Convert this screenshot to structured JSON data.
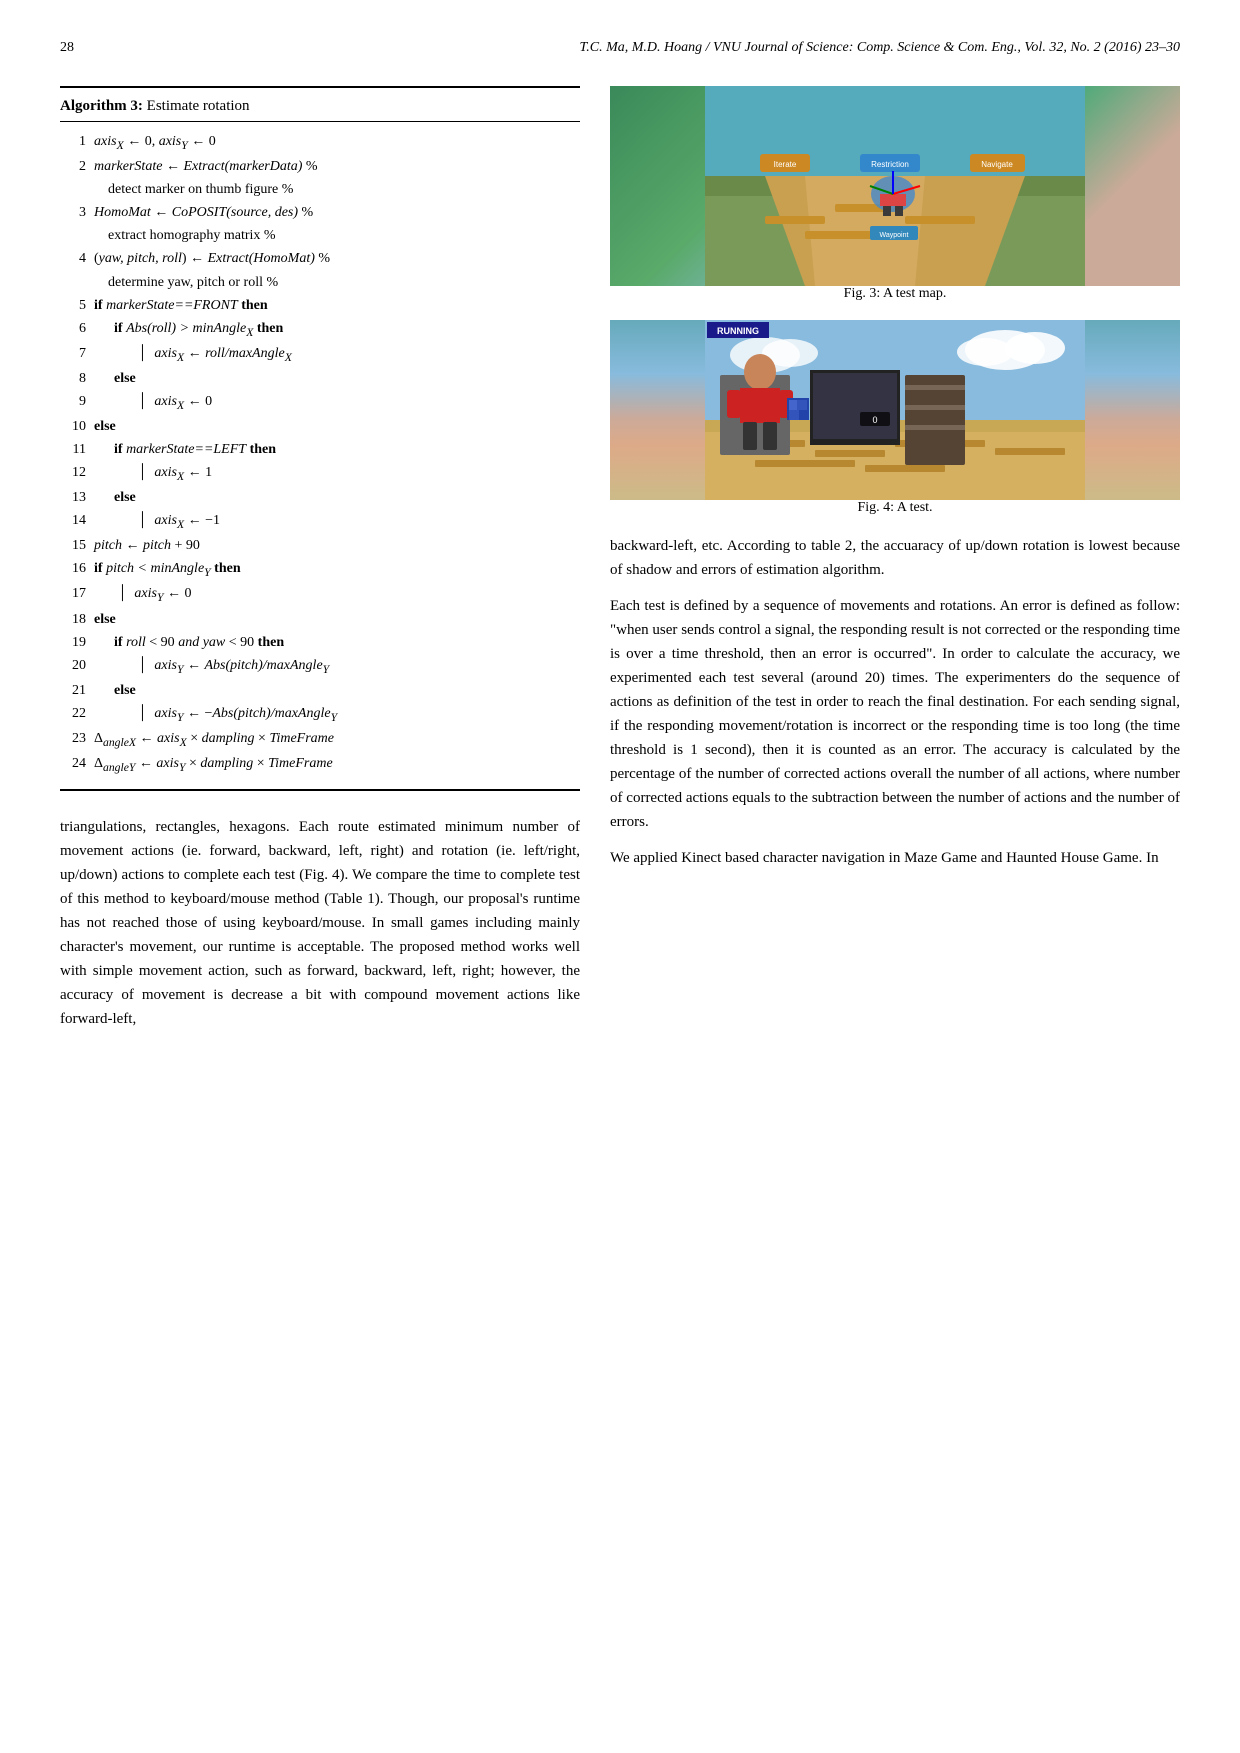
{
  "header": {
    "page_num": "28",
    "journal": "T.C. Ma, M.D. Hoang / VNU Journal of Science: Comp. Science & Com. Eng., Vol. 32, No. 2 (2016) 23–30"
  },
  "algorithm": {
    "title_label": "Algorithm 3:",
    "title_text": " Estimate rotation",
    "lines": [
      {
        "num": "1",
        "indent": 0,
        "html": "<span class='math'>axis<sub>X</sub></span> ← 0, <span class='math'>axis<sub>Y</sub></span> ← 0"
      },
      {
        "num": "2",
        "indent": 0,
        "html": "<span class='math'>markerState</span> ← <span class='math'>Extract(markerData)</span> % detect marker on thumb figure %"
      },
      {
        "num": "3",
        "indent": 0,
        "html": "<span class='math'>HomoMat</span> ← <span class='math'>CoPOSIT(source, des)</span> % extract homography matrix %"
      },
      {
        "num": "4",
        "indent": 0,
        "html": "(<span class='math'>yaw, pitch, roll</span>) ← <span class='math'>Extract(HomoMat)</span> % determine yaw, pitch or roll %"
      },
      {
        "num": "5",
        "indent": 0,
        "html": "<span class='kw-bold'>if</span> <span class='math'>markerState==FRONT</span> <span class='kw-bold'>then</span>"
      },
      {
        "num": "6",
        "indent": 1,
        "html": "<span class='kw-bold'>if</span> <span class='math'>Abs(roll) &gt; minAngle<sub>X</sub></span> <span class='kw-bold'>then</span>"
      },
      {
        "num": "7",
        "indent": 2,
        "html": "<span class='math'>axis<sub>X</sub></span> ← <span class='math'>roll/maxAngle<sub>X</sub></span>"
      },
      {
        "num": "8",
        "indent": 1,
        "html": "<span class='kw-bold'>else</span>"
      },
      {
        "num": "9",
        "indent": 2,
        "html": "<span class='math'>axis<sub>X</sub></span> ← 0"
      },
      {
        "num": "10",
        "indent": 0,
        "html": "<span class='kw-bold'>else</span>"
      },
      {
        "num": "11",
        "indent": 1,
        "html": "<span class='kw-bold'>if</span> <span class='math'>markerState==LEFT</span> <span class='kw-bold'>then</span>"
      },
      {
        "num": "12",
        "indent": 2,
        "html": "<span class='math'>axis<sub>X</sub></span> ← 1"
      },
      {
        "num": "13",
        "indent": 1,
        "html": "<span class='kw-bold'>else</span>"
      },
      {
        "num": "14",
        "indent": 2,
        "html": "<span class='math'>axis<sub>X</sub></span> ← −1"
      },
      {
        "num": "15",
        "indent": 0,
        "html": "<span class='math'>pitch</span> ← <span class='math'>pitch</span> + 90"
      },
      {
        "num": "16",
        "indent": 0,
        "html": "<span class='kw-bold'>if</span> <span class='math'>pitch &lt; minAngle<sub>Y</sub></span> <span class='kw-bold'>then</span>"
      },
      {
        "num": "17",
        "indent": 1,
        "html": "<span class='math'>axis<sub>Y</sub></span> ← 0"
      },
      {
        "num": "18",
        "indent": 0,
        "html": "<span class='kw-bold'>else</span>"
      },
      {
        "num": "19",
        "indent": 1,
        "html": "<span class='kw-bold'>if</span> <span class='math'>roll</span> &lt; 90 <span class='math'>and yaw</span> &lt; 90 <span class='kw-bold'>then</span>"
      },
      {
        "num": "20",
        "indent": 2,
        "html": "<span class='math'>axis<sub>Y</sub></span> ← <span class='math'>Abs(pitch)/maxAngle<sub>Y</sub></span>"
      },
      {
        "num": "21",
        "indent": 1,
        "html": "<span class='kw-bold'>else</span>"
      },
      {
        "num": "22",
        "indent": 2,
        "html": "<span class='math'>axis<sub>Y</sub></span> ← −<span class='math'>Abs(pitch)/maxAngle<sub>Y</sub></span>"
      },
      {
        "num": "23",
        "indent": 0,
        "html": "Δ<sub><span class='math'>angleX</span></sub> ← <span class='math'>axis<sub>X</sub></span> × <span class='math'>dampling</span> × <span class='math'>TimeFrame</span>"
      },
      {
        "num": "24",
        "indent": 0,
        "html": "Δ<sub><span class='math'>angleY</span></sub> ← <span class='math'>axis<sub>Y</sub></span> × <span class='math'>dampling</span> × <span class='math'>TimeFrame</span>"
      }
    ]
  },
  "figures": {
    "fig3": {
      "caption": "Fig. 3: A test map."
    },
    "fig4": {
      "caption": "Fig. 4: A test.",
      "badge": "RUNNING"
    }
  },
  "left_paragraphs": [
    "triangulations, rectangles, hexagons.  Each route estimated minimum number of movement actions (ie.  forward, backward, left, right) and rotation (ie. left/right, up/down) actions to complete each test (Fig. 4).  We compare the time to complete test of this method to keyboard/mouse method (Table 1). Though, our proposal's runtime has not reached those of using keyboard/mouse. In small games including mainly character's movement, our runtime is acceptable.  The proposed method works well with simple movement action, such as forward, backward, left, right; however, the accuracy of movement is decrease a bit with compound movement actions like forward-left,"
  ],
  "right_paragraphs": [
    "backward-left, etc.  According to table 2, the accuaracy of up/down rotation is lowest because of shadow and errors of estimation algorithm.",
    "Each test is defined by a sequence of movements and rotations.  An error is defined as follow: \"when user sends control a signal, the responding result is not corrected or the responding time is over a time threshold, then an error is occurred\".  In order to calculate the accuracy, we experimented each test several (around 20) times.  The experimenters do the sequence of actions as definition of the test in order to reach the final destination. For each sending signal, if the responding movement/rotation is incorrect or the responding time is too long (the time threshold is 1 second), then it is counted as an error.  The accuracy is calculated by the percentage of the number of corrected actions overall the number of all actions, where number of corrected actions equals to the subtraction between the number of actions and the number of errors.",
    "We applied Kinect based character navigation in Maze Game and Haunted House Game.  In"
  ]
}
